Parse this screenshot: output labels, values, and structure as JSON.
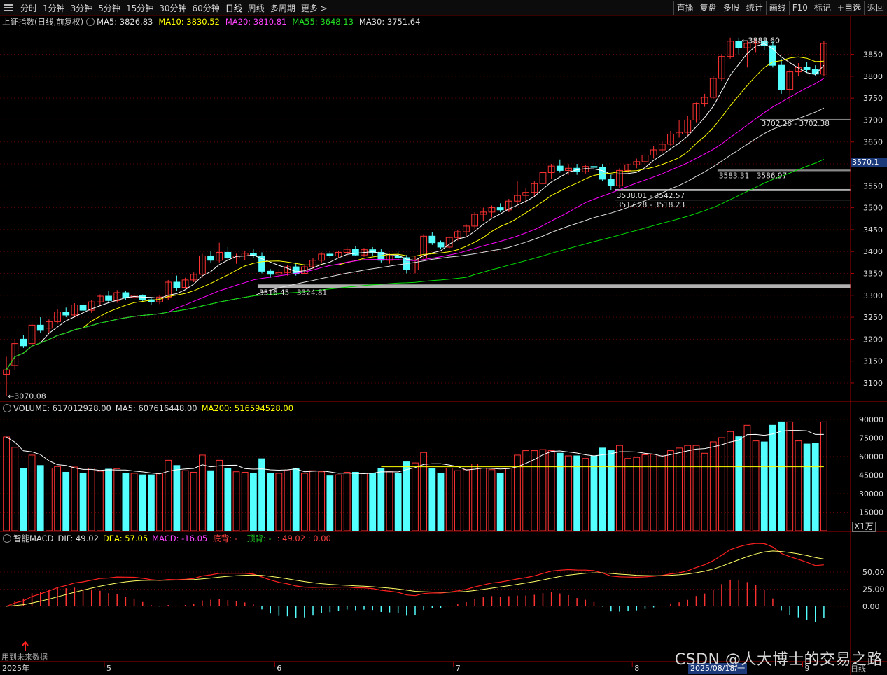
{
  "toolbar": {
    "tabs": [
      "分时",
      "1分钟",
      "3分钟",
      "5分钟",
      "15分钟",
      "30分钟",
      "60分钟",
      "日线",
      "周线",
      "多周期",
      "更多 >"
    ],
    "active_tab": "日线",
    "right_buttons": [
      "直播",
      "复盘",
      "多股",
      "统计",
      "画线",
      "F10",
      "标记",
      "+自选",
      "返回"
    ]
  },
  "price_header": {
    "title": "上证指数(日线,前复权)",
    "ma5": "MA5: 3826.83",
    "ma10": "MA10: 3830.52",
    "ma20": "MA20: 3810.81",
    "ma55": "MA55: 3648.13",
    "ma30": "MA30: 3751.64"
  },
  "volume_header": {
    "volume": "VOLUME: 617012928.00",
    "ma5": "MA5: 607616448.00",
    "ma200": "MA200: 516594528.00"
  },
  "macd_header": {
    "title": "智能MACD",
    "dif": "DIF: 49.02",
    "dea": "DEA: 57.05",
    "macd": "MACD: -16.05",
    "bottom_div": "底背: -",
    "top_div": "顶背: -",
    "extra": ": 49.02 : 0.00"
  },
  "price_axis": [
    "3850",
    "3800",
    "3750",
    "3700",
    "3650",
    "3600",
    "3550",
    "3500",
    "3450",
    "3400",
    "3350",
    "3300",
    "3250",
    "3200",
    "3150",
    "3100"
  ],
  "volume_axis": [
    "90000",
    "75000",
    "60000",
    "45000",
    "30000",
    "15000"
  ],
  "volume_unit": "X1万",
  "macd_axis": [
    "50.00",
    "25.00",
    "0.00"
  ],
  "current_price": "3570.1",
  "annotations": {
    "high": "3888.60",
    "low": "3070.08",
    "gap1": "3702.26 - 3702.38",
    "gap2": "3583.31 - 3586.97",
    "gap3": "3538.01 - 3542.57",
    "gap4": "3517.28 - 3518.23",
    "gap5": "3316.45 - 3324.81"
  },
  "x_axis": {
    "year": "2025年",
    "months": [
      "5",
      "6",
      "7",
      "8",
      "9"
    ],
    "date_badge": "2025/08/18/一",
    "period": "日线"
  },
  "future_note": "用到未来数据",
  "watermark": "CSDN @人大博士的交易之路",
  "colors": {
    "up": "#ff3232",
    "down": "#54ffff",
    "ma5": "#ffffff",
    "ma10": "#ffff00",
    "ma20": "#ff00ff",
    "ma30": "#dddddd",
    "ma55": "#00dd00",
    "axis": "#aa0000"
  },
  "chart_data": {
    "type": "candlestick",
    "ohlc_approx": [
      [
        3120,
        3160,
        3070,
        3130
      ],
      [
        3140,
        3200,
        3130,
        3190
      ],
      [
        3200,
        3210,
        3180,
        3185
      ],
      [
        3190,
        3240,
        3185,
        3232
      ],
      [
        3232,
        3250,
        3215,
        3220
      ],
      [
        3225,
        3245,
        3215,
        3240
      ],
      [
        3240,
        3268,
        3235,
        3262
      ],
      [
        3262,
        3272,
        3250,
        3255
      ],
      [
        3255,
        3282,
        3250,
        3278
      ],
      [
        3278,
        3282,
        3262,
        3266
      ],
      [
        3266,
        3290,
        3260,
        3285
      ],
      [
        3285,
        3302,
        3278,
        3298
      ],
      [
        3298,
        3310,
        3282,
        3288
      ],
      [
        3288,
        3312,
        3283,
        3306
      ],
      [
        3306,
        3310,
        3290,
        3295
      ],
      [
        3295,
        3305,
        3285,
        3300
      ],
      [
        3300,
        3302,
        3285,
        3290
      ],
      [
        3290,
        3295,
        3278,
        3285
      ],
      [
        3285,
        3300,
        3280,
        3296
      ],
      [
        3296,
        3335,
        3290,
        3330
      ],
      [
        3330,
        3345,
        3310,
        3318
      ],
      [
        3318,
        3340,
        3315,
        3335
      ],
      [
        3335,
        3352,
        3330,
        3348
      ],
      [
        3348,
        3395,
        3340,
        3390
      ],
      [
        3390,
        3400,
        3375,
        3380
      ],
      [
        3380,
        3420,
        3375,
        3398
      ],
      [
        3398,
        3410,
        3380,
        3385
      ],
      [
        3385,
        3395,
        3372,
        3390
      ],
      [
        3390,
        3402,
        3380,
        3396
      ],
      [
        3396,
        3405,
        3385,
        3390
      ],
      [
        3390,
        3398,
        3350,
        3355
      ],
      [
        3355,
        3360,
        3340,
        3348
      ],
      [
        3348,
        3360,
        3340,
        3352
      ],
      [
        3352,
        3370,
        3345,
        3365
      ],
      [
        3365,
        3375,
        3345,
        3350
      ],
      [
        3350,
        3368,
        3348,
        3365
      ],
      [
        3365,
        3385,
        3360,
        3380
      ],
      [
        3380,
        3398,
        3375,
        3394
      ],
      [
        3394,
        3400,
        3385,
        3390
      ],
      [
        3390,
        3402,
        3385,
        3398
      ],
      [
        3398,
        3410,
        3388,
        3405
      ],
      [
        3405,
        3412,
        3390,
        3392
      ],
      [
        3392,
        3408,
        3388,
        3404
      ],
      [
        3404,
        3410,
        3390,
        3398
      ],
      [
        3398,
        3405,
        3375,
        3380
      ],
      [
        3380,
        3395,
        3372,
        3390
      ],
      [
        3390,
        3400,
        3380,
        3386
      ],
      [
        3386,
        3392,
        3350,
        3358
      ],
      [
        3358,
        3390,
        3350,
        3385
      ],
      [
        3385,
        3440,
        3380,
        3435
      ],
      [
        3435,
        3445,
        3415,
        3420
      ],
      [
        3420,
        3425,
        3405,
        3410
      ],
      [
        3410,
        3435,
        3405,
        3432
      ],
      [
        3432,
        3450,
        3425,
        3445
      ],
      [
        3445,
        3462,
        3435,
        3458
      ],
      [
        3458,
        3490,
        3452,
        3485
      ],
      [
        3485,
        3500,
        3470,
        3490
      ],
      [
        3490,
        3505,
        3478,
        3500
      ],
      [
        3500,
        3510,
        3490,
        3495
      ],
      [
        3495,
        3520,
        3490,
        3515
      ],
      [
        3515,
        3560,
        3505,
        3528
      ],
      [
        3528,
        3545,
        3510,
        3535
      ],
      [
        3535,
        3560,
        3525,
        3555
      ],
      [
        3555,
        3585,
        3548,
        3580
      ],
      [
        3580,
        3600,
        3565,
        3595
      ],
      [
        3595,
        3610,
        3580,
        3585
      ],
      [
        3585,
        3600,
        3575,
        3590
      ],
      [
        3590,
        3600,
        3575,
        3582
      ],
      [
        3582,
        3598,
        3578,
        3594
      ],
      [
        3594,
        3610,
        3585,
        3592
      ],
      [
        3592,
        3600,
        3560,
        3565
      ],
      [
        3565,
        3575,
        3540,
        3550
      ],
      [
        3550,
        3590,
        3545,
        3585
      ],
      [
        3585,
        3600,
        3580,
        3598
      ],
      [
        3598,
        3612,
        3590,
        3605
      ],
      [
        3605,
        3625,
        3598,
        3620
      ],
      [
        3620,
        3640,
        3612,
        3632
      ],
      [
        3632,
        3650,
        3625,
        3645
      ],
      [
        3645,
        3675,
        3640,
        3668
      ],
      [
        3668,
        3700,
        3660,
        3672
      ],
      [
        3672,
        3710,
        3665,
        3700
      ],
      [
        3700,
        3740,
        3695,
        3738
      ],
      [
        3738,
        3760,
        3730,
        3752
      ],
      [
        3752,
        3800,
        3748,
        3795
      ],
      [
        3795,
        3850,
        3790,
        3845
      ],
      [
        3845,
        3888,
        3840,
        3880
      ],
      [
        3880,
        3888,
        3850,
        3865
      ],
      [
        3865,
        3880,
        3820,
        3875
      ],
      [
        3875,
        3885,
        3855,
        3880
      ],
      [
        3880,
        3888,
        3860,
        3870
      ],
      [
        3870,
        3880,
        3820,
        3825
      ],
      [
        3825,
        3840,
        3760,
        3770
      ],
      [
        3770,
        3815,
        3740,
        3810
      ],
      [
        3810,
        3830,
        3800,
        3820
      ],
      [
        3820,
        3832,
        3808,
        3815
      ],
      [
        3815,
        3825,
        3800,
        3805
      ],
      [
        3805,
        3880,
        3800,
        3875
      ]
    ],
    "price_range": [
      3060,
      3910
    ],
    "volume_range": [
      0,
      95000
    ],
    "macd_range": [
      -80,
      90
    ]
  }
}
